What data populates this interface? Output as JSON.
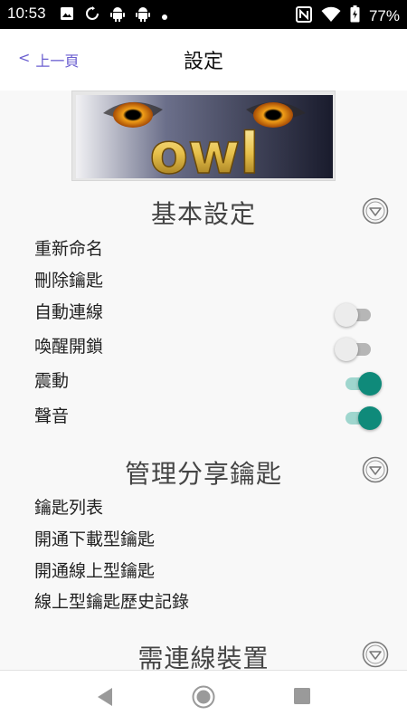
{
  "status_bar": {
    "time": "10:53",
    "battery_percent": "77%",
    "left_icons": [
      "image-icon",
      "sync-icon",
      "android-icon",
      "android-icon",
      "dot-icon"
    ],
    "right_icons": [
      "nfc-icon",
      "wifi-icon",
      "battery-icon"
    ]
  },
  "header": {
    "back_arrow": "<",
    "back_label": "上一頁",
    "title": "設定"
  },
  "logo": {
    "text": "owl"
  },
  "sections": {
    "basic": {
      "title": "基本設定",
      "rename": "重新命名",
      "delete_key": "刪除鑰匙",
      "auto_connect": "自動連線",
      "wake_unlock": "喚醒開鎖",
      "vibrate": "震動",
      "sound": "聲音"
    },
    "share": {
      "title": "管理分享鑰匙",
      "key_list": "鑰匙列表",
      "activate_download_key": "開通下載型鑰匙",
      "activate_online_key": "開通線上型鑰匙",
      "online_key_history": "線上型鑰匙歷史記錄"
    },
    "connect": {
      "title": "需連線裝置"
    }
  },
  "toggles": {
    "auto_connect": false,
    "wake_unlock": false,
    "vibrate": true,
    "sound": true
  },
  "colors": {
    "accent": "#0f8a7a",
    "accent_track": "#9fd6ce",
    "link": "#6b5fd0",
    "status_bar": "#000000"
  }
}
